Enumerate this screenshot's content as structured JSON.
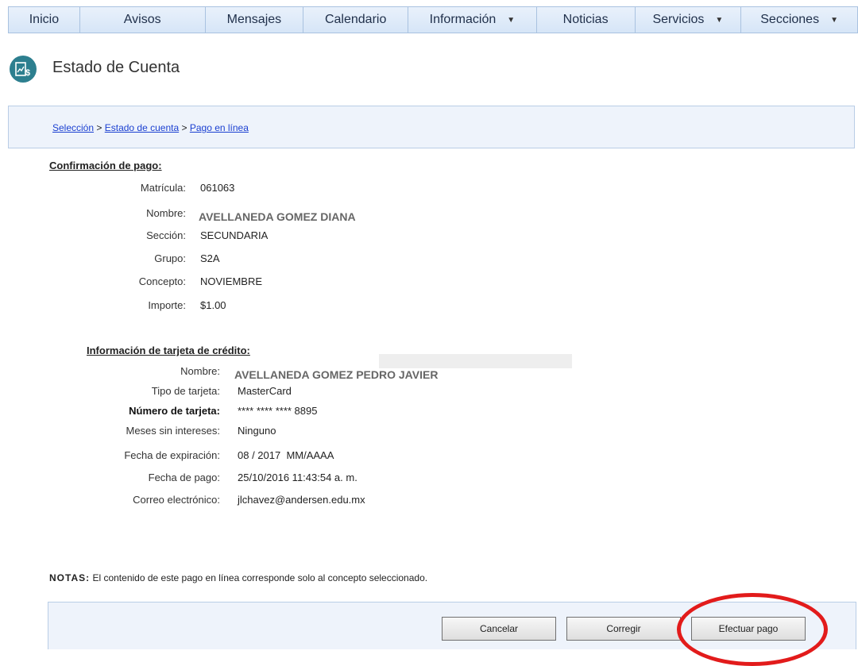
{
  "nav": {
    "items": [
      {
        "label": "Inicio",
        "caret": false
      },
      {
        "label": "Avisos",
        "caret": false
      },
      {
        "label": "Mensajes",
        "caret": false
      },
      {
        "label": "Calendario",
        "caret": false
      },
      {
        "label": "Información",
        "caret": true
      },
      {
        "label": "Noticias",
        "caret": false
      },
      {
        "label": "Servicios",
        "caret": true
      },
      {
        "label": "Secciones",
        "caret": true
      }
    ]
  },
  "header": {
    "title": "Estado de Cuenta",
    "icon": "account-statement-icon"
  },
  "breadcrumb": {
    "items": [
      "Selección",
      "Estado de cuenta",
      "Pago en línea"
    ],
    "separator": ">"
  },
  "payment": {
    "title": "Confirmación de pago:",
    "matricula_label": "Matrícula:",
    "matricula": "061063",
    "nombre_label": "Nombre:",
    "nombre": "AVELLANEDA GOMEZ DIANA",
    "seccion_label": "Sección:",
    "seccion": "SECUNDARIA",
    "grupo_label": "Grupo:",
    "grupo": "S2A",
    "concepto_label": "Concepto:",
    "concepto": "NOVIEMBRE",
    "importe_label": "Importe:",
    "importe": "$1.00"
  },
  "card": {
    "title": "Información de tarjeta de crédito:",
    "nombre_label": "Nombre:",
    "nombre": "AVELLANEDA GOMEZ PEDRO JAVIER",
    "tipo_label": "Tipo de tarjeta:",
    "tipo": "MasterCard",
    "numero_label": "Número de tarjeta:",
    "numero": "**** **** **** 8895",
    "meses_label": "Meses sin intereses:",
    "meses": "Ninguno",
    "expiracion_label": "Fecha de expiración:",
    "expiracion": "08 / 2017  MM/AAAA",
    "fecha_pago_label": "Fecha de pago:",
    "fecha_pago": "25/10/2016 11:43:54 a. m.",
    "correo_label": "Correo electrónico:",
    "correo": "jlchavez@andersen.edu.mx"
  },
  "notes": {
    "label": "NOTAS:",
    "text": "El contenido de este pago en línea corresponde solo al concepto seleccionado."
  },
  "buttons": {
    "cancel": "Cancelar",
    "correct": "Corregir",
    "pay": "Efectuar pago"
  },
  "colors": {
    "highlight_circle": "#e21b1b",
    "nav_bg": "#dce8f7",
    "panel_bg": "#eef3fb",
    "link": "#1a3fd1"
  }
}
